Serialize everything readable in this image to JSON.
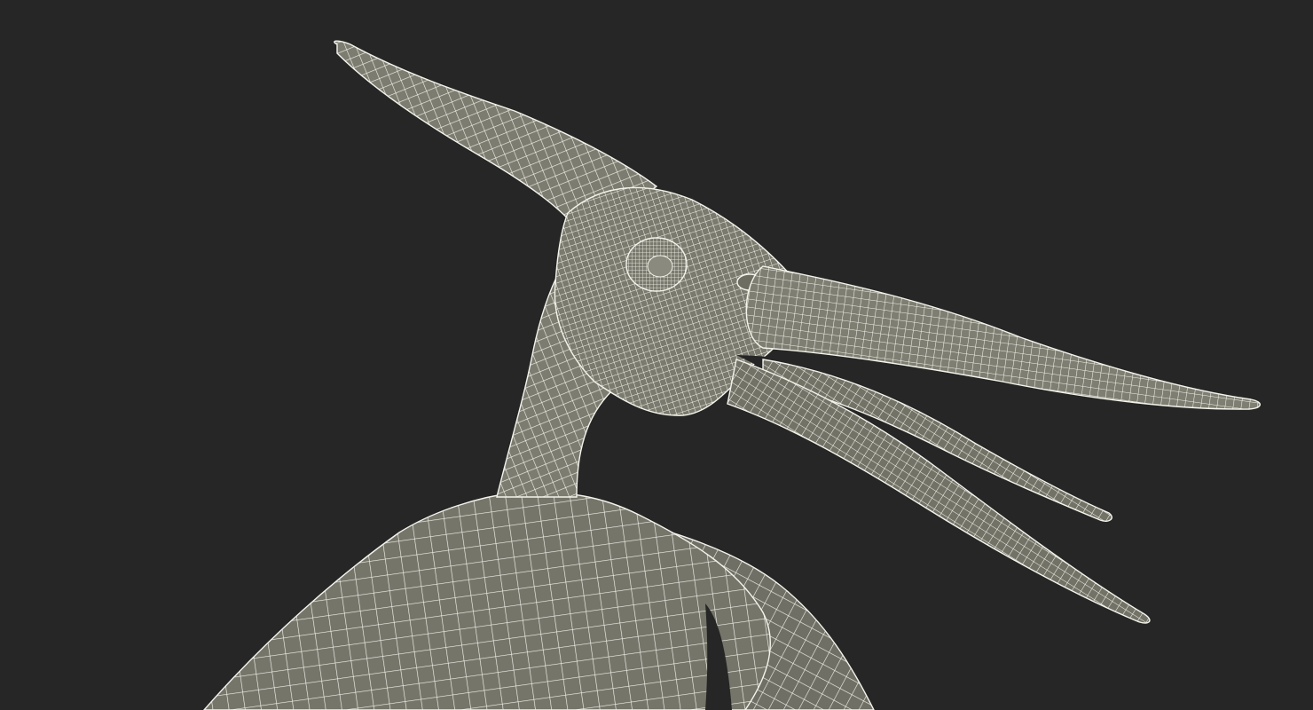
{
  "viewport": {
    "background_color": "#262626",
    "subject": "pteranodon-wireframe-model"
  },
  "model": {
    "surface_color": "#7c7c70",
    "shade_color": "#5d5d53",
    "wire_color": "#f4f4ec"
  }
}
